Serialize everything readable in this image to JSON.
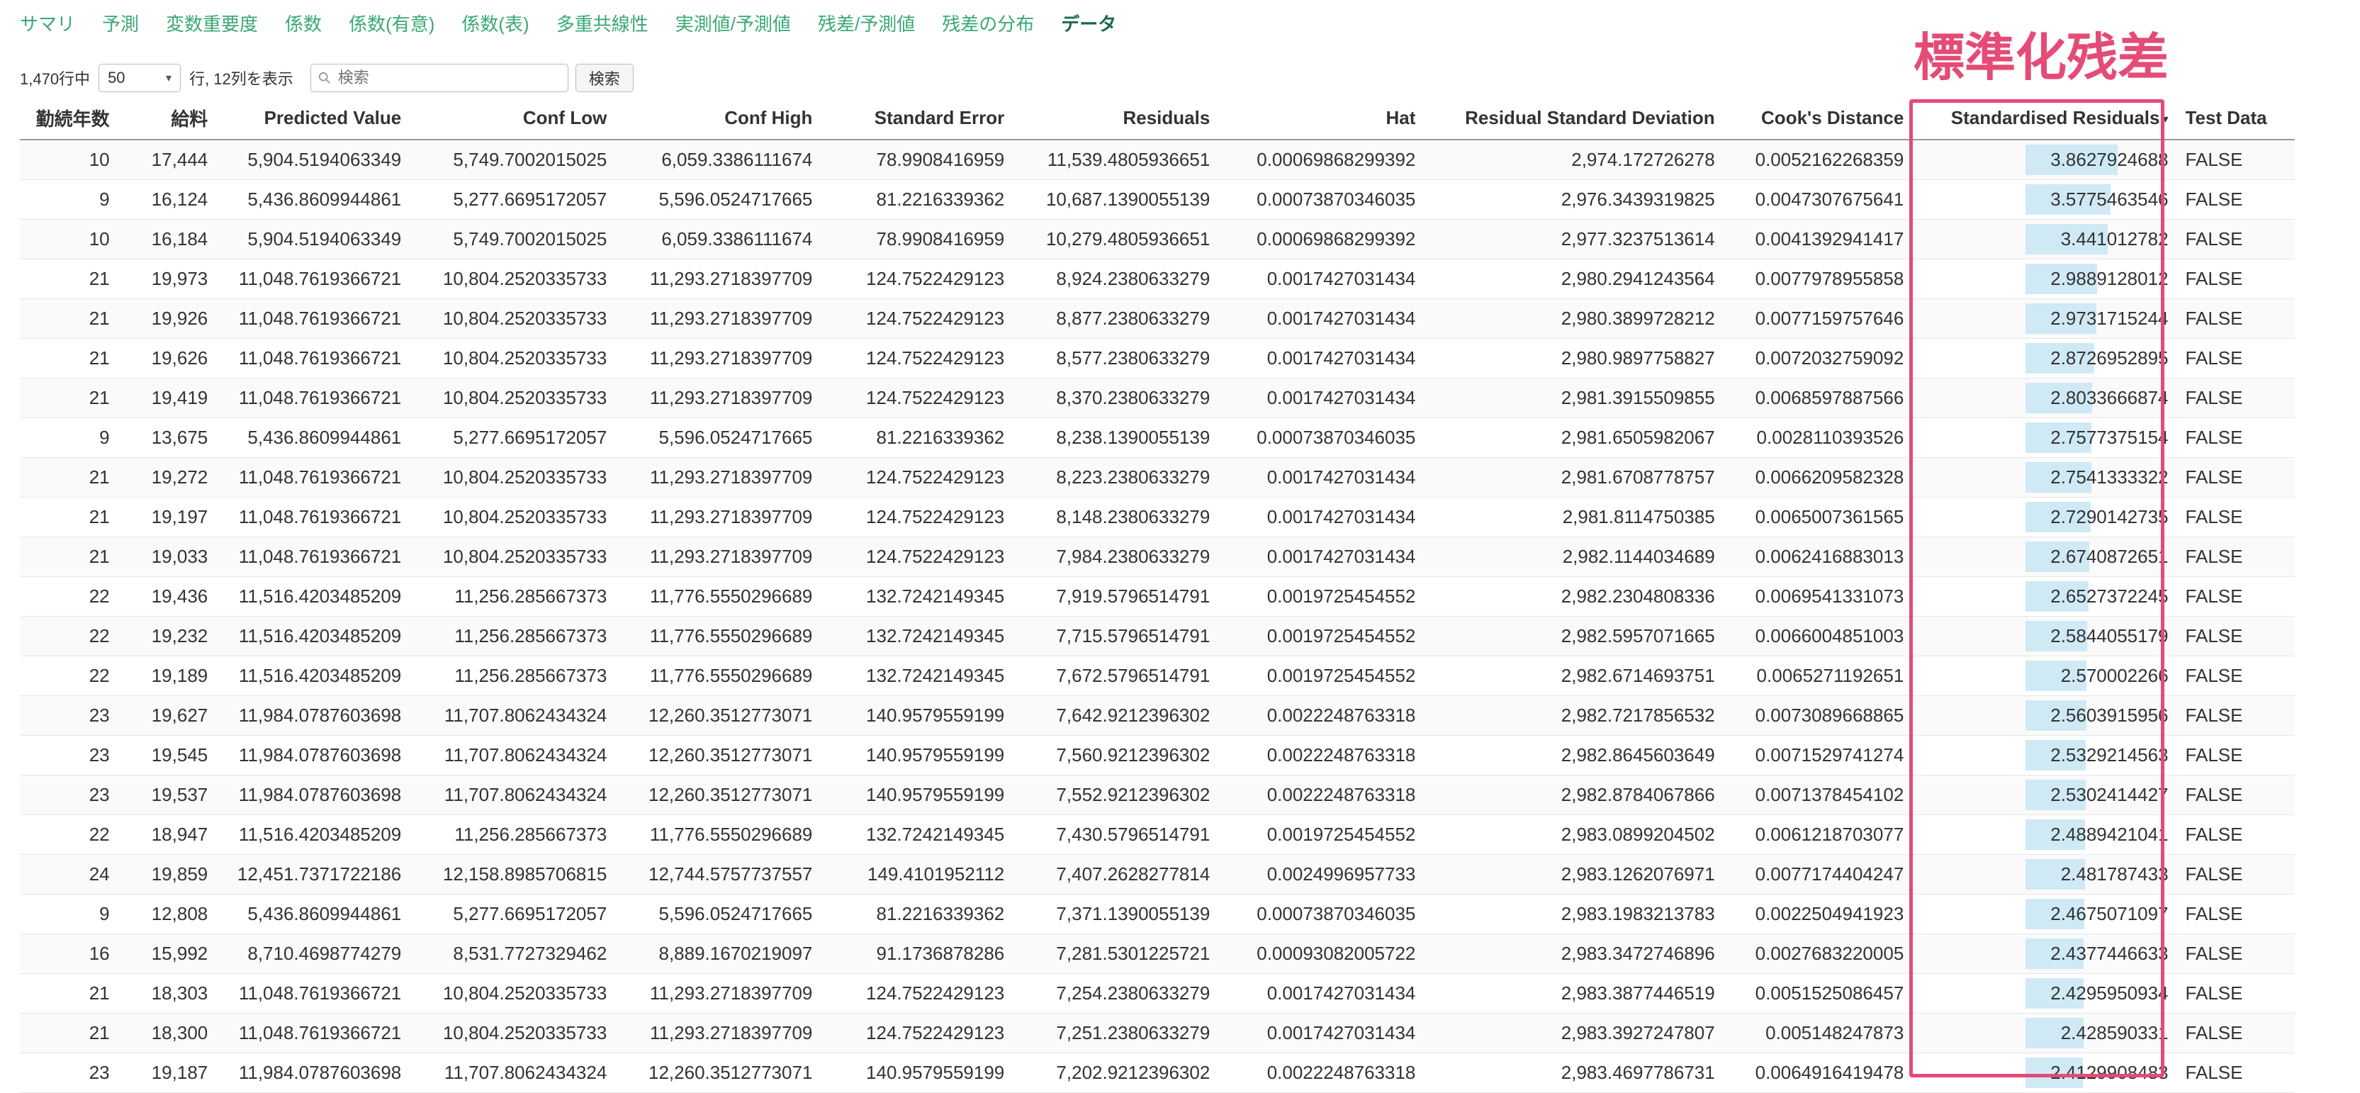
{
  "tabs": [
    "サマリ",
    "予測",
    "変数重要度",
    "係数",
    "係数(有意)",
    "係数(表)",
    "多重共線性",
    "実測値/予測値",
    "残差/予測値",
    "残差の分布",
    "データ"
  ],
  "active_tab": "データ",
  "controls": {
    "row_count": "1,470行中",
    "page_size": "50",
    "row_info": "行, 12列を表示",
    "search_placeholder": "検索",
    "search_button": "検索"
  },
  "annotation": "標準化残差",
  "colors": {
    "tab_link": "#3aa876",
    "highlight": "#e44b76",
    "bar": "#cfe9f5"
  },
  "icons": {
    "search": "search-icon",
    "sort": "sort-desc-icon",
    "dropdown": "chevron-down-icon"
  },
  "table": {
    "columns": [
      "勤続年数",
      "給料",
      "Predicted Value",
      "Conf Low",
      "Conf High",
      "Standard Error",
      "Residuals",
      "Hat",
      "Residual Standard Deviation",
      "Cook's Distance",
      "Standardised Residuals",
      "Test Data"
    ],
    "rows": [
      [
        "10",
        "17,444",
        "5,904.5194063349",
        "5,749.7002015025",
        "6,059.3386111674",
        "78.9908416959",
        "11,539.4805936651",
        "0.00069868299392",
        "2,974.172726278",
        "0.0052162268359",
        "3.8627924688",
        "FALSE"
      ],
      [
        "9",
        "16,124",
        "5,436.8609944861",
        "5,277.6695172057",
        "5,596.0524717665",
        "81.2216339362",
        "10,687.1390055139",
        "0.00073870346035",
        "2,976.3439319825",
        "0.0047307675641",
        "3.5775463546",
        "FALSE"
      ],
      [
        "10",
        "16,184",
        "5,904.5194063349",
        "5,749.7002015025",
        "6,059.3386111674",
        "78.9908416959",
        "10,279.4805936651",
        "0.00069868299392",
        "2,977.3237513614",
        "0.0041392941417",
        "3.441012782",
        "FALSE"
      ],
      [
        "21",
        "19,973",
        "11,048.7619366721",
        "10,804.2520335733",
        "11,293.2718397709",
        "124.7522429123",
        "8,924.2380633279",
        "0.0017427031434",
        "2,980.2941243564",
        "0.0077978955858",
        "2.9889128012",
        "FALSE"
      ],
      [
        "21",
        "19,926",
        "11,048.7619366721",
        "10,804.2520335733",
        "11,293.2718397709",
        "124.7522429123",
        "8,877.2380633279",
        "0.0017427031434",
        "2,980.3899728212",
        "0.0077159757646",
        "2.9731715244",
        "FALSE"
      ],
      [
        "21",
        "19,626",
        "11,048.7619366721",
        "10,804.2520335733",
        "11,293.2718397709",
        "124.7522429123",
        "8,577.2380633279",
        "0.0017427031434",
        "2,980.9897758827",
        "0.0072032759092",
        "2.8726952895",
        "FALSE"
      ],
      [
        "21",
        "19,419",
        "11,048.7619366721",
        "10,804.2520335733",
        "11,293.2718397709",
        "124.7522429123",
        "8,370.2380633279",
        "0.0017427031434",
        "2,981.3915509855",
        "0.0068597887566",
        "2.8033666874",
        "FALSE"
      ],
      [
        "9",
        "13,675",
        "5,436.8609944861",
        "5,277.6695172057",
        "5,596.0524717665",
        "81.2216339362",
        "8,238.1390055139",
        "0.00073870346035",
        "2,981.6505982067",
        "0.0028110393526",
        "2.7577375154",
        "FALSE"
      ],
      [
        "21",
        "19,272",
        "11,048.7619366721",
        "10,804.2520335733",
        "11,293.2718397709",
        "124.7522429123",
        "8,223.2380633279",
        "0.0017427031434",
        "2,981.6708778757",
        "0.0066209582328",
        "2.7541333322",
        "FALSE"
      ],
      [
        "21",
        "19,197",
        "11,048.7619366721",
        "10,804.2520335733",
        "11,293.2718397709",
        "124.7522429123",
        "8,148.2380633279",
        "0.0017427031434",
        "2,981.8114750385",
        "0.0065007361565",
        "2.7290142735",
        "FALSE"
      ],
      [
        "21",
        "19,033",
        "11,048.7619366721",
        "10,804.2520335733",
        "11,293.2718397709",
        "124.7522429123",
        "7,984.2380633279",
        "0.0017427031434",
        "2,982.1144034689",
        "0.0062416883013",
        "2.6740872651",
        "FALSE"
      ],
      [
        "22",
        "19,436",
        "11,516.4203485209",
        "11,256.285667373",
        "11,776.5550296689",
        "132.7242149345",
        "7,919.5796514791",
        "0.0019725454552",
        "2,982.2304808336",
        "0.0069541331073",
        "2.6527372245",
        "FALSE"
      ],
      [
        "22",
        "19,232",
        "11,516.4203485209",
        "11,256.285667373",
        "11,776.5550296689",
        "132.7242149345",
        "7,715.5796514791",
        "0.0019725454552",
        "2,982.5957071665",
        "0.0066004851003",
        "2.5844055179",
        "FALSE"
      ],
      [
        "22",
        "19,189",
        "11,516.4203485209",
        "11,256.285667373",
        "11,776.5550296689",
        "132.7242149345",
        "7,672.5796514791",
        "0.0019725454552",
        "2,982.6714693751",
        "0.0065271192651",
        "2.570002266",
        "FALSE"
      ],
      [
        "23",
        "19,627",
        "11,984.0787603698",
        "11,707.8062434324",
        "12,260.3512773071",
        "140.9579559199",
        "7,642.9212396302",
        "0.0022248763318",
        "2,982.7217856532",
        "0.0073089668865",
        "2.5603915956",
        "FALSE"
      ],
      [
        "23",
        "19,545",
        "11,984.0787603698",
        "11,707.8062434324",
        "12,260.3512773071",
        "140.9579559199",
        "7,560.9212396302",
        "0.0022248763318",
        "2,982.8645603649",
        "0.0071529741274",
        "2.5329214563",
        "FALSE"
      ],
      [
        "23",
        "19,537",
        "11,984.0787603698",
        "11,707.8062434324",
        "12,260.3512773071",
        "140.9579559199",
        "7,552.9212396302",
        "0.0022248763318",
        "2,982.8784067866",
        "0.0071378454102",
        "2.5302414427",
        "FALSE"
      ],
      [
        "22",
        "18,947",
        "11,516.4203485209",
        "11,256.285667373",
        "11,776.5550296689",
        "132.7242149345",
        "7,430.5796514791",
        "0.0019725454552",
        "2,983.0899204502",
        "0.0061218703077",
        "2.4889421041",
        "FALSE"
      ],
      [
        "24",
        "19,859",
        "12,451.7371722186",
        "12,158.8985706815",
        "12,744.5757737557",
        "149.4101952112",
        "7,407.2628277814",
        "0.0024996957733",
        "2,983.1262076971",
        "0.0077174404247",
        "2.481787433",
        "FALSE"
      ],
      [
        "9",
        "12,808",
        "5,436.8609944861",
        "5,277.6695172057",
        "5,596.0524717665",
        "81.2216339362",
        "7,371.1390055139",
        "0.00073870346035",
        "2,983.1983213783",
        "0.0022504941923",
        "2.4675071097",
        "FALSE"
      ],
      [
        "16",
        "15,992",
        "8,710.4698774279",
        "8,531.7727329462",
        "8,889.1670219097",
        "91.1736878286",
        "7,281.5301225721",
        "0.00093082005722",
        "2,983.3472746896",
        "0.0027683220005",
        "2.4377446633",
        "FALSE"
      ],
      [
        "21",
        "18,303",
        "11,048.7619366721",
        "10,804.2520335733",
        "11,293.2718397709",
        "124.7522429123",
        "7,254.2380633279",
        "0.0017427031434",
        "2,983.3877446519",
        "0.0051525086457",
        "2.4295950934",
        "FALSE"
      ],
      [
        "21",
        "18,300",
        "11,048.7619366721",
        "10,804.2520335733",
        "11,293.2718397709",
        "124.7522429123",
        "7,251.2380633279",
        "0.0017427031434",
        "2,983.3927247807",
        "0.005148247873",
        "2.428590331",
        "FALSE"
      ],
      [
        "23",
        "19,187",
        "11,984.0787603698",
        "11,707.8062434324",
        "12,260.3512773071",
        "140.9579559199",
        "7,202.9212396302",
        "0.0022248763318",
        "2,983.4697786731",
        "0.0064916419478",
        "2.4129908483",
        "FALSE"
      ]
    ]
  }
}
